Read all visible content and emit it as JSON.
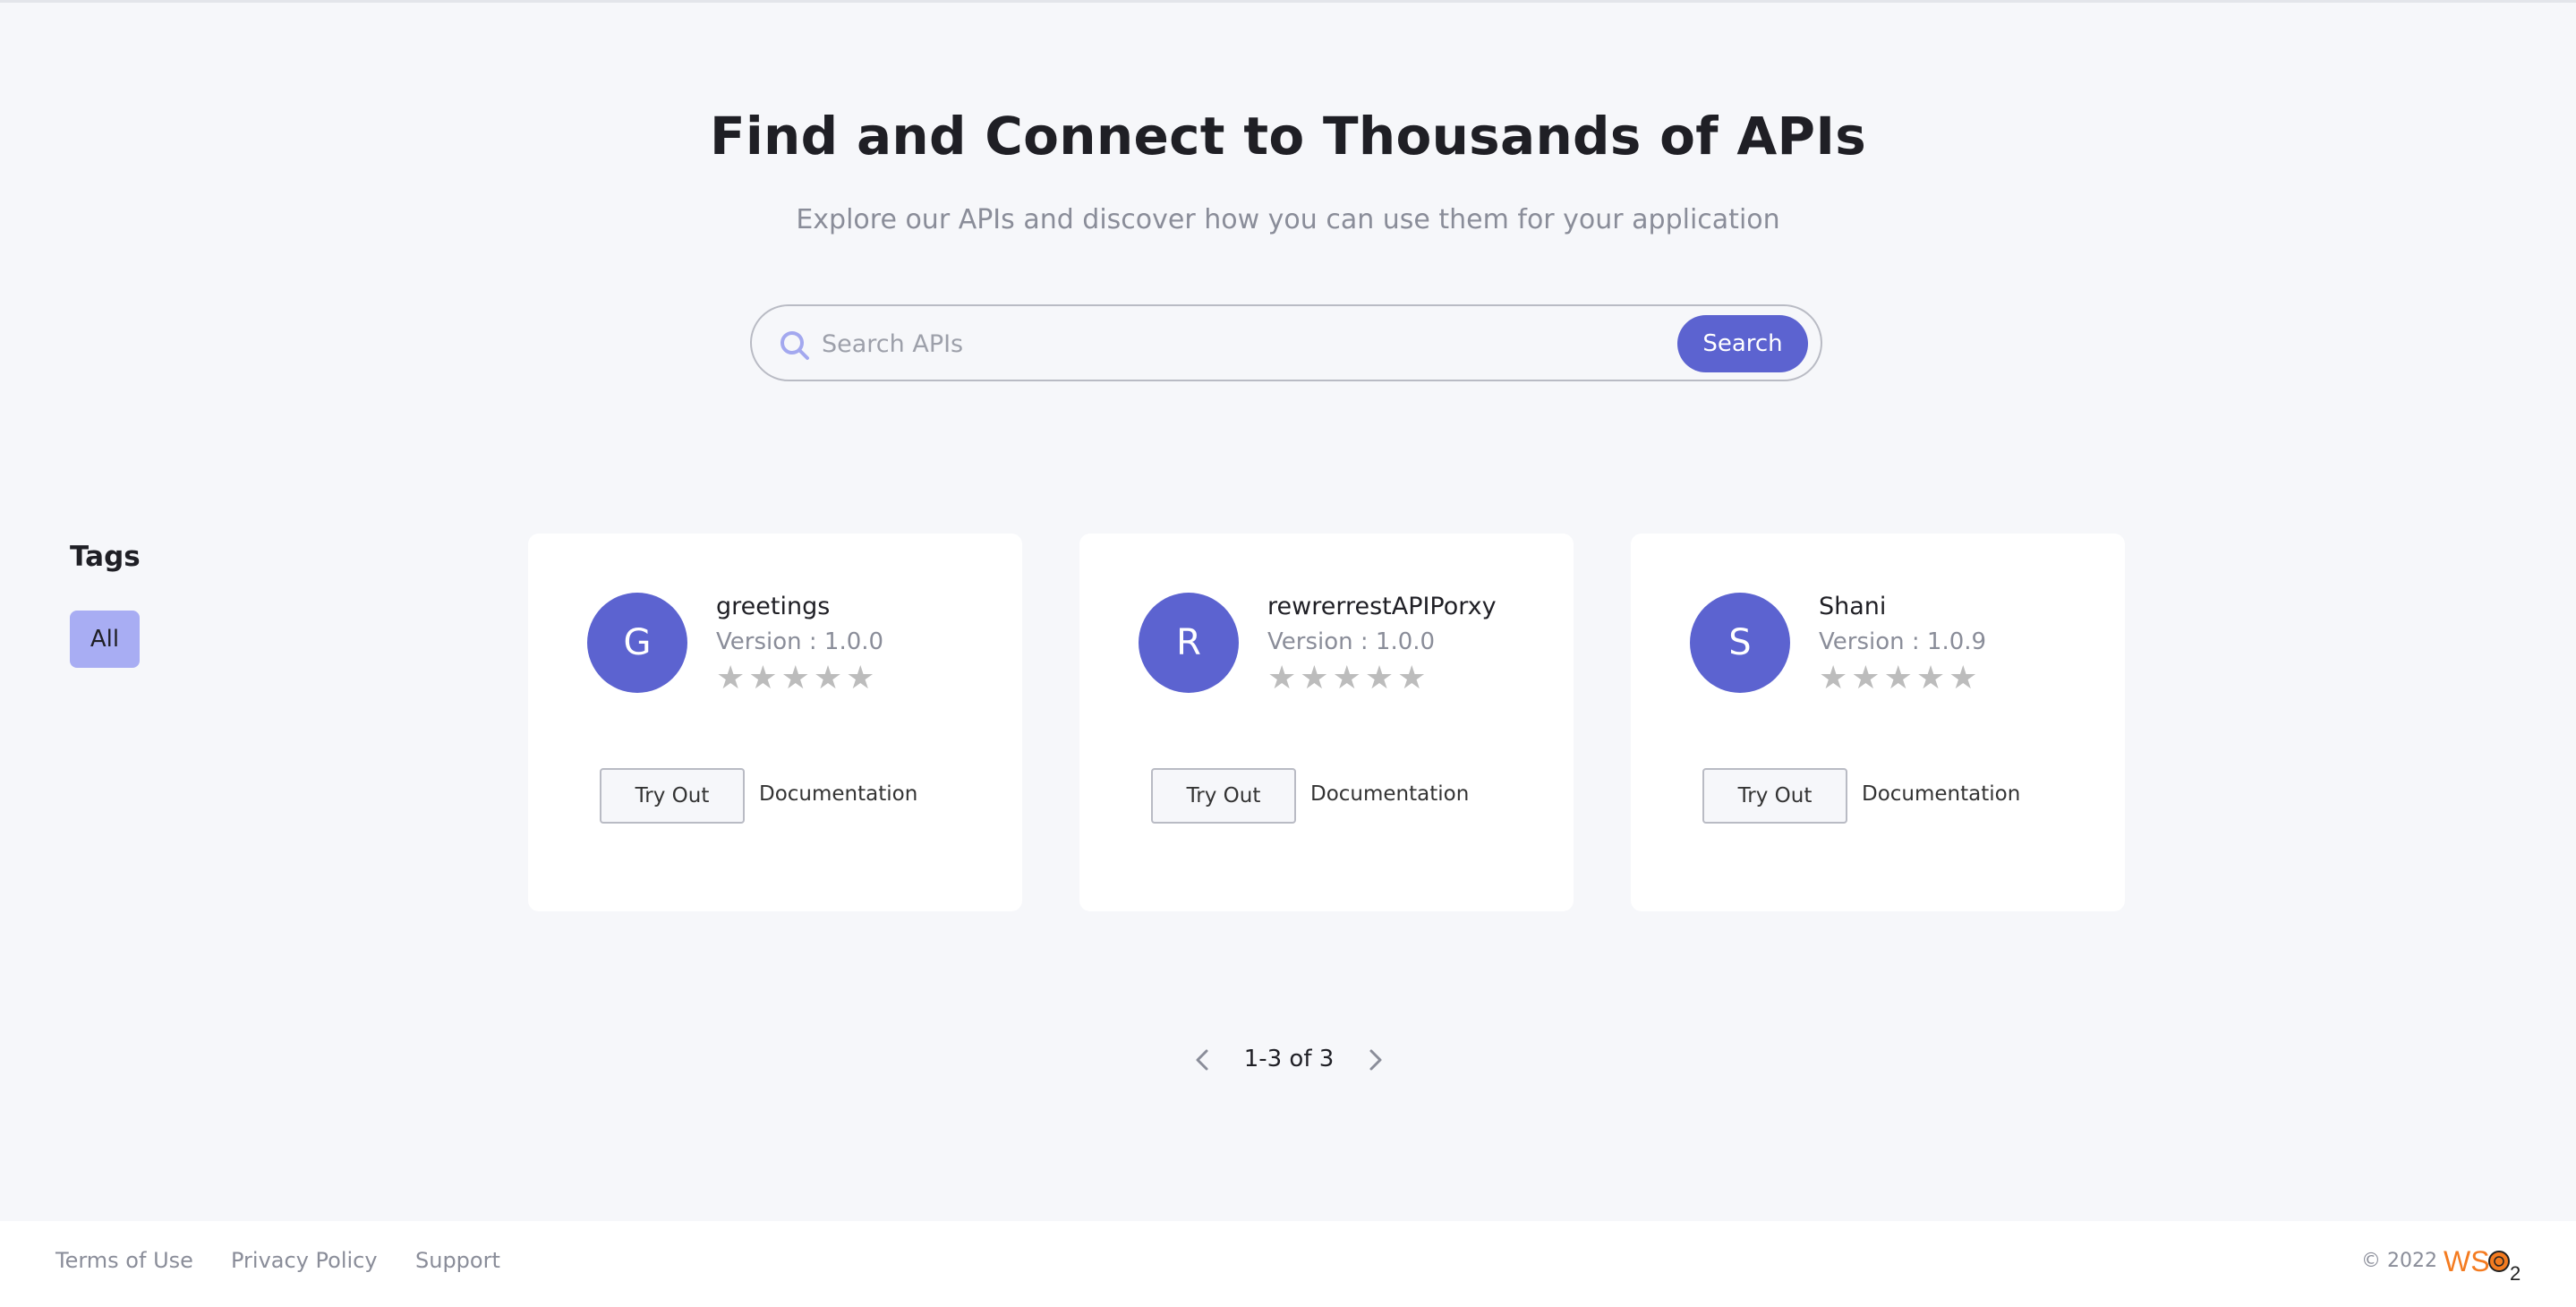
{
  "hero": {
    "title": "Find and Connect to Thousands of APIs",
    "subtitle": "Explore our APIs and discover how you can use them for your application"
  },
  "search": {
    "placeholder": "Search APIs",
    "value": "",
    "button_label": "Search",
    "icon": "search-icon"
  },
  "tags": {
    "heading": "Tags",
    "items": [
      {
        "label": "All",
        "selected": true
      }
    ]
  },
  "apis": [
    {
      "initial": "G",
      "name": "greetings",
      "version": "Version : 1.0.0",
      "rating": 0,
      "max_rating": 5,
      "try_out_label": "Try Out",
      "documentation_label": "Documentation"
    },
    {
      "initial": "R",
      "name": "rewrerrestAPIPorxy",
      "version": "Version : 1.0.0",
      "rating": 0,
      "max_rating": 5,
      "try_out_label": "Try Out",
      "documentation_label": "Documentation"
    },
    {
      "initial": "S",
      "name": "Shani",
      "version": "Version : 1.0.9",
      "rating": 0,
      "max_rating": 5,
      "try_out_label": "Try Out",
      "documentation_label": "Documentation"
    }
  ],
  "pagination": {
    "label": "1-3 of 3",
    "prev_icon": "chevron-left-icon",
    "next_icon": "chevron-right-icon"
  },
  "footer": {
    "links": [
      "Terms of Use",
      "Privacy Policy",
      "Support"
    ],
    "copyright": "© 2022",
    "logo_text": "WSO2"
  },
  "colors": {
    "accent": "#5c63d0",
    "tag_chip": "#a8adf3",
    "background": "#f6f7fa",
    "muted_text": "#8a8d99",
    "star_empty": "#bcbcbc",
    "logo_orange": "#f47b20"
  }
}
